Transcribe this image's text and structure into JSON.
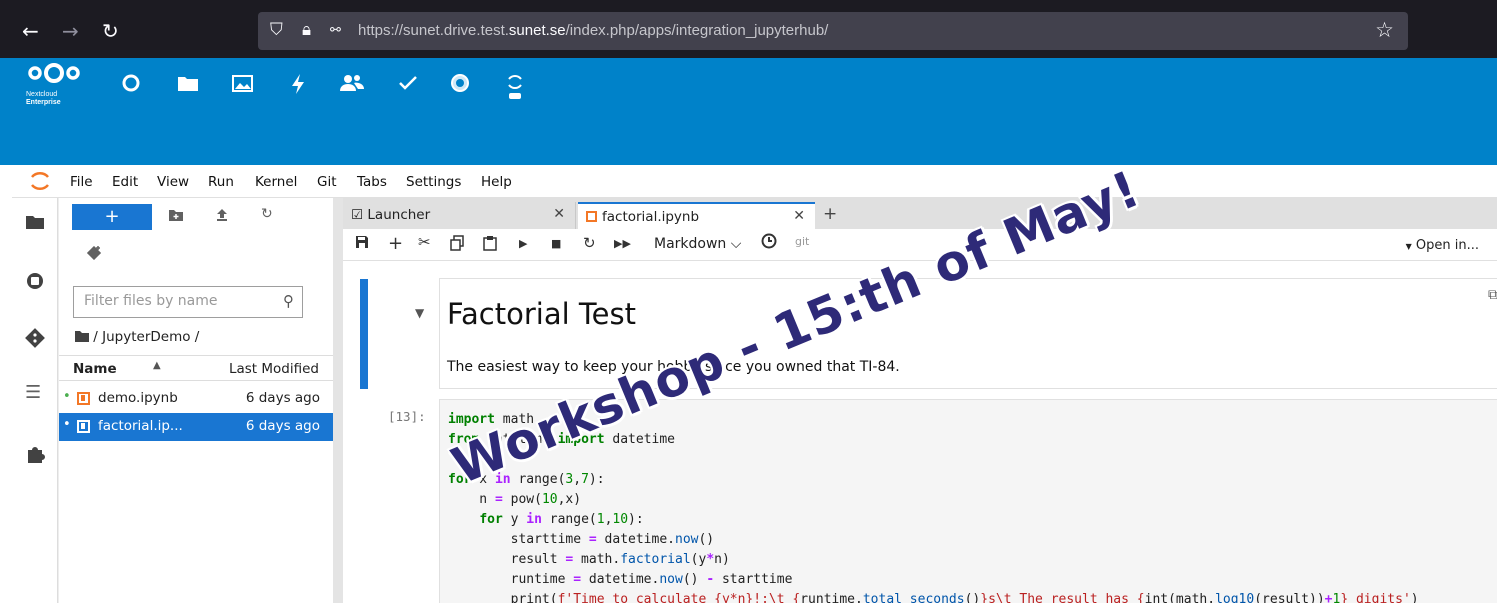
{
  "browser": {
    "url_pre": "https://sunet.drive.test.",
    "url_host": "sunet.se",
    "url_post": "/index.php/apps/integration_jupyterhub/"
  },
  "nextcloud": {
    "logo_line1": "Nextcloud",
    "logo_line2": "Enterprise",
    "apps": [
      "dashboard-icon",
      "files-icon",
      "photos-icon",
      "activity-icon",
      "contacts-icon",
      "tasks-icon",
      "app-icon",
      "jupyter-icon"
    ]
  },
  "menu": [
    "File",
    "Edit",
    "View",
    "Run",
    "Kernel",
    "Git",
    "Tabs",
    "Settings",
    "Help"
  ],
  "filebrowser": {
    "new_label": "+",
    "filter_placeholder": "Filter files by name",
    "breadcrumb": "/ JupyterDemo /",
    "col_name": "Name",
    "col_modified": "Last Modified",
    "files": [
      {
        "name": "demo.ipynb",
        "modified": "6 days ago"
      },
      {
        "name": "factorial.ip...",
        "modified": "6 days ago"
      }
    ]
  },
  "tabs": [
    {
      "label": "Launcher"
    },
    {
      "label": "factorial.ipynb"
    }
  ],
  "toolbar": {
    "cell_type": "Markdown",
    "git_label": "git",
    "open_in": "Open in..."
  },
  "notebook": {
    "md_title": "Factorial Test",
    "md_text": "The easiest way to keep your hobby since you owned that TI-84.",
    "prompt": "[13]:"
  },
  "banner": "Workshop - 15:th of May!",
  "colors": {
    "nextcloud_blue": "#0082c9",
    "jupyter_orange": "#f37726",
    "selection_blue": "#1976d2",
    "banner_text": "#2e2a78"
  }
}
